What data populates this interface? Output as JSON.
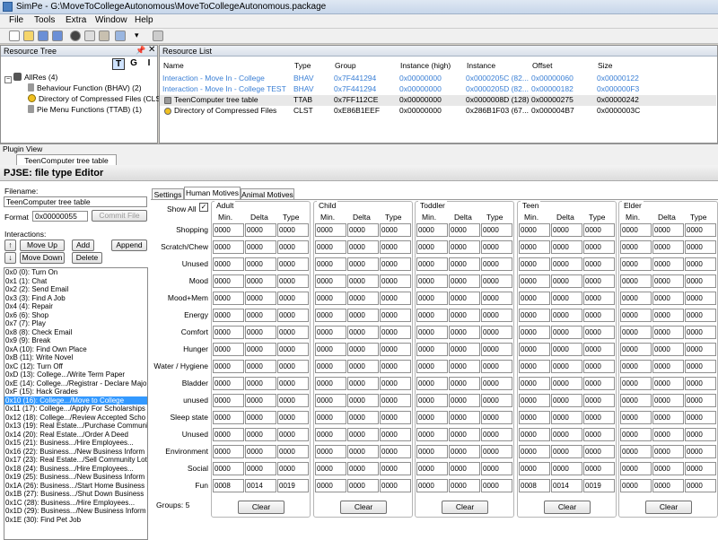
{
  "window": {
    "title": "SimPe - G:\\MoveToCollegeAutonomous\\MoveToCollegeAutonomous.package"
  },
  "menu": [
    "File",
    "Tools",
    "Extra",
    "Window",
    "Help"
  ],
  "resource_tree": {
    "title": "Resource Tree",
    "btn_t": "T",
    "btn_g": "G",
    "btn_i": "I",
    "items": [
      "AllRes (4)",
      "Behaviour Function (BHAV) (2)",
      "Directory of Compressed Files (CLST",
      "Pie Menu Functions (TTAB) (1)"
    ]
  },
  "resource_list": {
    "title": "Resource List",
    "columns": [
      "Name",
      "Type",
      "Group",
      "Instance (high)",
      "Instance",
      "Offset",
      "Size"
    ],
    "rows": [
      [
        "Interaction - Move In - College",
        "BHAV",
        "0x7F441294",
        "0x00000000",
        "0x0000205C (82...",
        "0x00000060",
        "0x00000122"
      ],
      [
        "Interaction - Move In - College TEST",
        "BHAV",
        "0x7F441294",
        "0x00000000",
        "0x0000205D (82...",
        "0x00000182",
        "0x000000F3"
      ],
      [
        "TeenComputer tree table",
        "TTAB",
        "0x7FF112CE",
        "0x00000000",
        "0x0000008D (128)",
        "0x00000275",
        "0x00000242"
      ],
      [
        "Directory of Compressed Files",
        "CLST",
        "0xE86B1EEF",
        "0x00000000",
        "0x286B1F03 (67...",
        "0x000004B7",
        "0x0000003C"
      ]
    ]
  },
  "plugin_view": {
    "label": "Plugin View",
    "tab": "TeenComputer tree table"
  },
  "editor": {
    "title": "PJSE: file type Editor",
    "filename_label": "Filename:",
    "filename": "TeenComputer tree table",
    "format_label": "Format",
    "format_value": "0x00000055",
    "commit": "Commit File",
    "interactions_label": "Interactions:",
    "move_up": "Move Up",
    "move_down": "Move Down",
    "add": "Add",
    "append": "Append",
    "delete": "Delete",
    "interactions": [
      "0x0 (0): Turn On",
      "0x1 (1): Chat",
      "0x2 (2): Send Email",
      "0x3 (3): Find A Job",
      "0x4 (4): Repair",
      "0x6 (6): Shop",
      "0x7 (7): Play",
      "0x8 (8): Check Email",
      "0x9 (9): Break",
      "0xA (10): Find Own Place",
      "0xB (11): Write Novel",
      "0xC (12): Turn Off",
      "0xD (13): College.../Write Term Paper",
      "0xE (14): College.../Registrar - Declare Majo",
      "0xF (15): Hack Grades",
      "0x10 (16): College.../Move to College",
      "0x11 (17): College.../Apply For Scholarships",
      "0x12 (18): College.../Review Accepted Scho",
      "0x13 (19): Real Estate.../Purchase Communi",
      "0x14 (20): Real Estate.../Order A Deed",
      "0x15 (21): Business.../Hire Employees...",
      "0x16 (22): Business.../New Business Inform",
      "0x17 (23): Real Estate.../Sell Community Lot",
      "0x18 (24): Business.../Hire Employees...",
      "0x19 (25): Business.../New Business Inform",
      "0x1A (26): Business.../Start Home Business",
      "0x1B (27): Business.../Shut Down Business",
      "0x1C (28): Business.../Hire Employees...",
      "0x1D (29): Business.../New Business Inform",
      "0x1E (30): Find Pet Job"
    ],
    "selected_index": 15,
    "tabs": [
      "Settings",
      "Human Motives",
      "Animal Motives"
    ],
    "show_all": "Show All",
    "groups": [
      "Adult",
      "Child",
      "Toddler",
      "Teen",
      "Elder"
    ],
    "subcols": [
      "Min.",
      "Delta",
      "Type"
    ],
    "motives": [
      "Shopping",
      "Scratch/Chew",
      "Unused",
      "Mood",
      "Mood+Mem",
      "Energy",
      "Comfort",
      "Hunger",
      "Water / Hygiene",
      "Bladder",
      "unused",
      "Sleep state",
      "Unused",
      "Environment",
      "Social",
      "Fun"
    ],
    "fun_values": [
      "0008",
      "0014",
      "0019"
    ],
    "zero": "0000",
    "groups_count": "Groups: 5",
    "clear": "Clear"
  }
}
